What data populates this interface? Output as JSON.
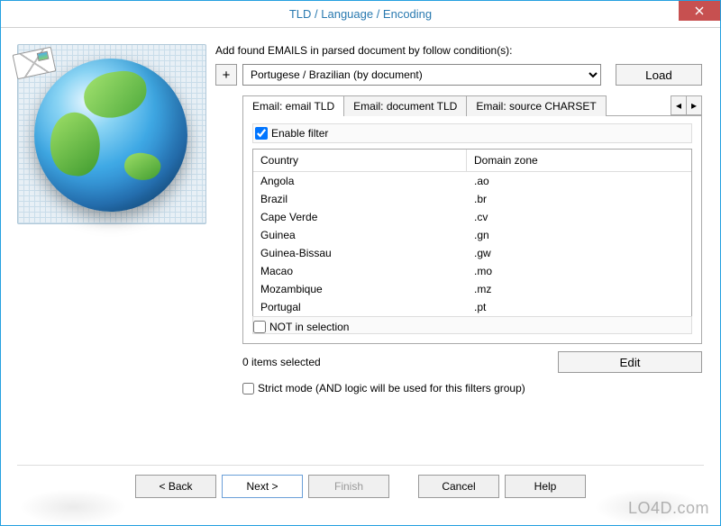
{
  "window": {
    "title": "TLD / Language / Encoding"
  },
  "prompt": "Add found EMAILS in parsed document by follow condition(s):",
  "row1": {
    "plus_label": "+",
    "combo_selected": "Portugese / Brazilian (by document)",
    "load_label": "Load"
  },
  "tabs": {
    "items": [
      {
        "label": "Email: email TLD"
      },
      {
        "label": "Email: document TLD"
      },
      {
        "label": "Email: source CHARSET"
      }
    ],
    "left_arrow": "◂",
    "right_arrow": "▸"
  },
  "panel": {
    "enable_filter_label": "Enable filter",
    "enable_filter_checked": true,
    "columns": {
      "country": "Country",
      "domain_zone": "Domain zone"
    },
    "rows": [
      {
        "country": "Angola",
        "zone": ".ao"
      },
      {
        "country": "Brazil",
        "zone": ".br"
      },
      {
        "country": "Cape Verde",
        "zone": ".cv"
      },
      {
        "country": "Guinea",
        "zone": ".gn"
      },
      {
        "country": "Guinea-Bissau",
        "zone": ".gw"
      },
      {
        "country": "Macao",
        "zone": ".mo"
      },
      {
        "country": "Mozambique",
        "zone": ".mz"
      },
      {
        "country": "Portugal",
        "zone": ".pt"
      }
    ],
    "not_in_selection_label": "NOT in selection",
    "not_in_selection_checked": false
  },
  "status": {
    "items_selected_text": "0 items selected",
    "edit_label": "Edit"
  },
  "strict_mode": {
    "label": "Strict mode (AND logic will be used for this filters group)",
    "checked": false
  },
  "footer": {
    "back": "< Back",
    "next": "Next >",
    "finish": "Finish",
    "cancel": "Cancel",
    "help": "Help"
  },
  "watermark": "LO4D.com"
}
